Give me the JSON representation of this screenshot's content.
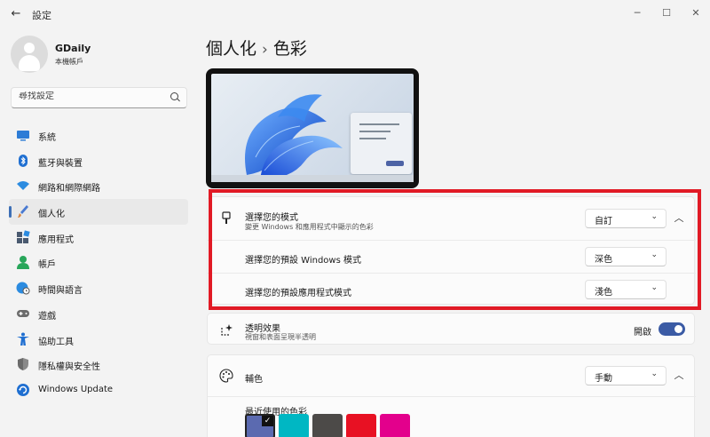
{
  "window": {
    "title": "設定",
    "back": "←",
    "minimize": "─",
    "maximize": "☐",
    "close": "✕"
  },
  "profile": {
    "name": "GDaily",
    "subtitle": "本機帳戶"
  },
  "search": {
    "placeholder": "尋找設定"
  },
  "sidebar": {
    "items": [
      {
        "label": "系統",
        "icon": "monitor-icon",
        "color": "#2d7cd6"
      },
      {
        "label": "藍牙與裝置",
        "icon": "bluetooth-icon",
        "color": "#1f6fd1"
      },
      {
        "label": "網路和網際網路",
        "icon": "wifi-icon",
        "color": "#2b8be0"
      },
      {
        "label": "個人化",
        "icon": "brush-icon",
        "color": "#d8843d",
        "active": true
      },
      {
        "label": "應用程式",
        "icon": "apps-icon",
        "color": "#4a5a70"
      },
      {
        "label": "帳戶",
        "icon": "person-icon",
        "color": "#28a65a"
      },
      {
        "label": "時間與語言",
        "icon": "globe-clock-icon",
        "color": "#2b8be0"
      },
      {
        "label": "遊戲",
        "icon": "gamepad-icon",
        "color": "#6b6b6b"
      },
      {
        "label": "協助工具",
        "icon": "accessibility-icon",
        "color": "#1f6fd1"
      },
      {
        "label": "隱私權與安全性",
        "icon": "shield-icon",
        "color": "#7a7a7a"
      },
      {
        "label": "Windows Update",
        "icon": "update-icon",
        "color": "#1f6fd1"
      }
    ]
  },
  "breadcrumb": {
    "parent": "個人化",
    "separator": "›",
    "current": "色彩"
  },
  "mode_card": {
    "title": "選擇您的模式",
    "subtitle": "變更 Windows 和應用程式中顯示的色彩",
    "value": "自訂",
    "collapse_icon": "chevron-up-icon",
    "windows_mode": {
      "label": "選擇您的預設 Windows 模式",
      "value": "深色"
    },
    "app_mode": {
      "label": "選擇您的預設應用程式模式",
      "value": "淺色"
    }
  },
  "transparency": {
    "title": "透明效果",
    "subtitle": "視窗和表面呈現半透明",
    "state": "開啟",
    "on": true
  },
  "accent": {
    "title": "輔色",
    "value": "手動",
    "recent_label": "最近使用的色彩",
    "recent_colors": [
      "#5b6ab0",
      "#00b7c3",
      "#4c4a48",
      "#e81123",
      "#e3008c"
    ],
    "selected_index": 0
  },
  "chevron_down": "⌄",
  "chevron_up": "︿",
  "checkmark": "✓"
}
